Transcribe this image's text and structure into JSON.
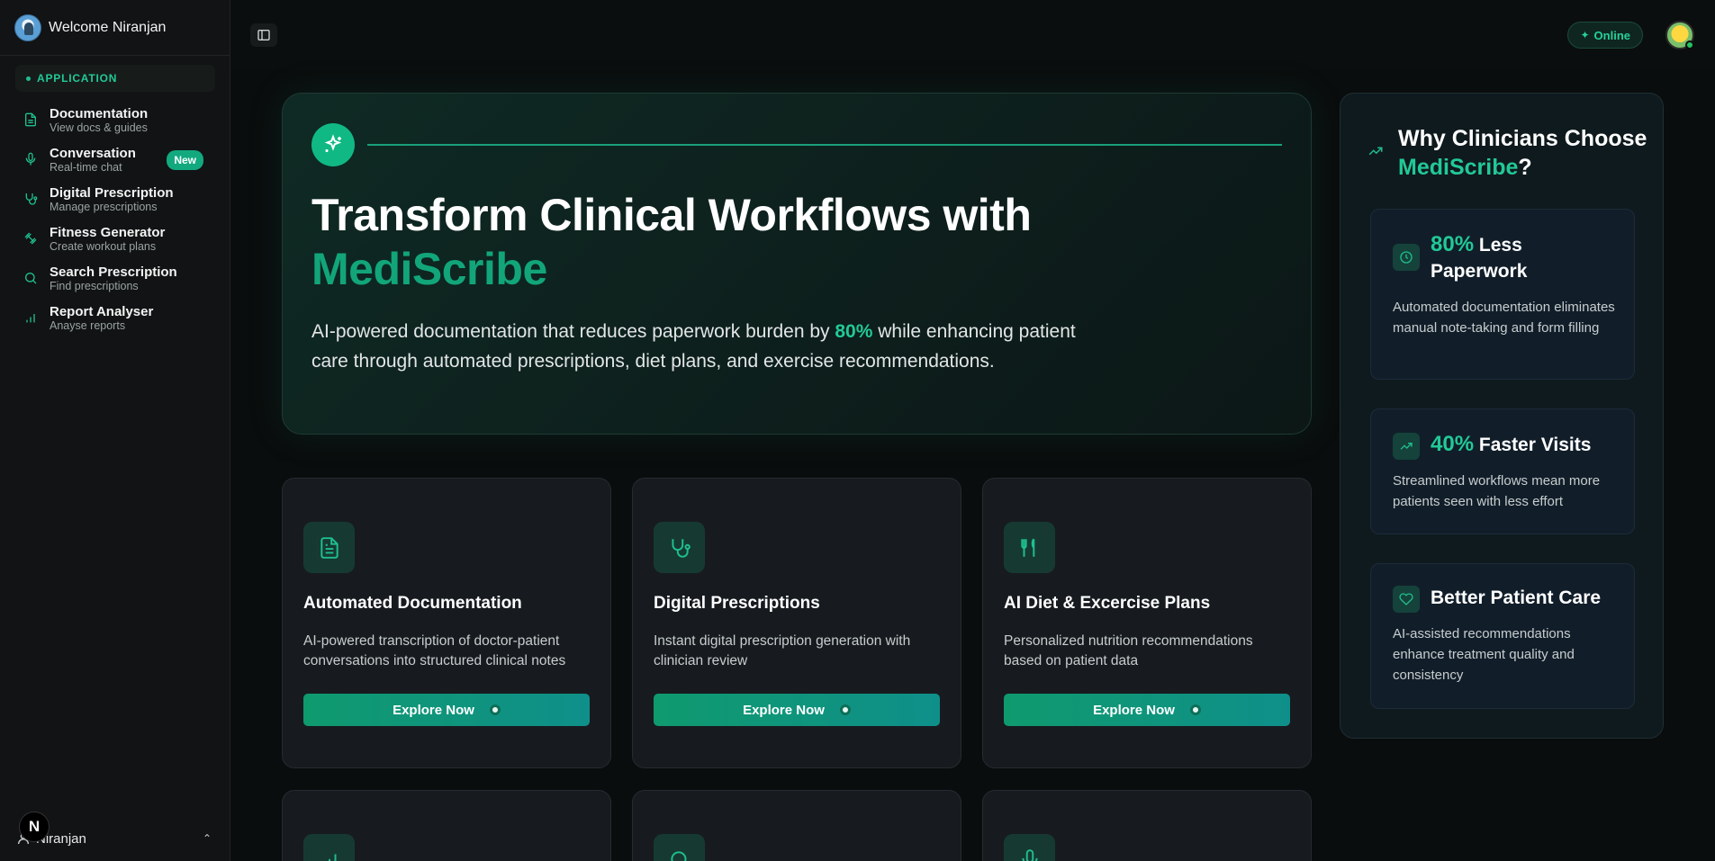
{
  "sidebar": {
    "welcome": "Welcome Niranjan",
    "section": "APPLICATION",
    "items": [
      {
        "title": "Documentation",
        "sub": "View docs & guides"
      },
      {
        "title": "Conversation",
        "sub": "Real-time chat",
        "badge": "New"
      },
      {
        "title": "Digital Prescription",
        "sub": "Manage prescriptions"
      },
      {
        "title": "Fitness Generator",
        "sub": "Create workout plans"
      },
      {
        "title": "Search Prescription",
        "sub": "Find prescriptions"
      },
      {
        "title": "Report Analyser",
        "sub": "Anayse reports"
      }
    ],
    "footer_name": "Niranjan",
    "n_badge": "N"
  },
  "topbar": {
    "status": "Online"
  },
  "hero": {
    "title_line1": "Transform Clinical Workflows with",
    "title_brand": "MediScribe",
    "desc_before": "AI-powered documentation that reduces paperwork burden by ",
    "desc_highlight": "80%",
    "desc_after": " while enhancing patient care through automated prescriptions, diet plans, and exercise recommendations."
  },
  "features": [
    {
      "title": "Automated Documentation",
      "desc": "AI-powered transcription of doctor-patient conversations into structured clinical notes",
      "button": "Explore Now",
      "icon": "document-icon"
    },
    {
      "title": "Digital Prescriptions",
      "desc": "Instant digital prescription generation with clinician review",
      "button": "Explore Now",
      "icon": "stethoscope-icon"
    },
    {
      "title": "AI Diet & Excercise Plans",
      "desc": "Personalized nutrition recommendations based on patient data",
      "button": "Explore Now",
      "icon": "utensils-icon"
    }
  ],
  "why": {
    "title_part1": "Why Clinicians Choose ",
    "title_brand": "MediScribe",
    "title_end": "?",
    "stats": [
      {
        "pct": "80%",
        "head": " Less Paperwork",
        "desc": "Automated documentation eliminates manual note-taking and form filling",
        "icon": "clock-icon"
      },
      {
        "pct": "40%",
        "head": " Faster Visits",
        "desc": "Streamlined workflows mean more patients seen with less effort",
        "icon": "trend-up-icon"
      },
      {
        "pct": "",
        "head": "Better Patient Care",
        "desc": "AI-assisted recommendations enhance treatment quality and consistency",
        "icon": "heart-icon"
      }
    ]
  },
  "colors": {
    "accent": "#22c996",
    "background": "#0a0d0d",
    "sidebar": "#121314"
  }
}
